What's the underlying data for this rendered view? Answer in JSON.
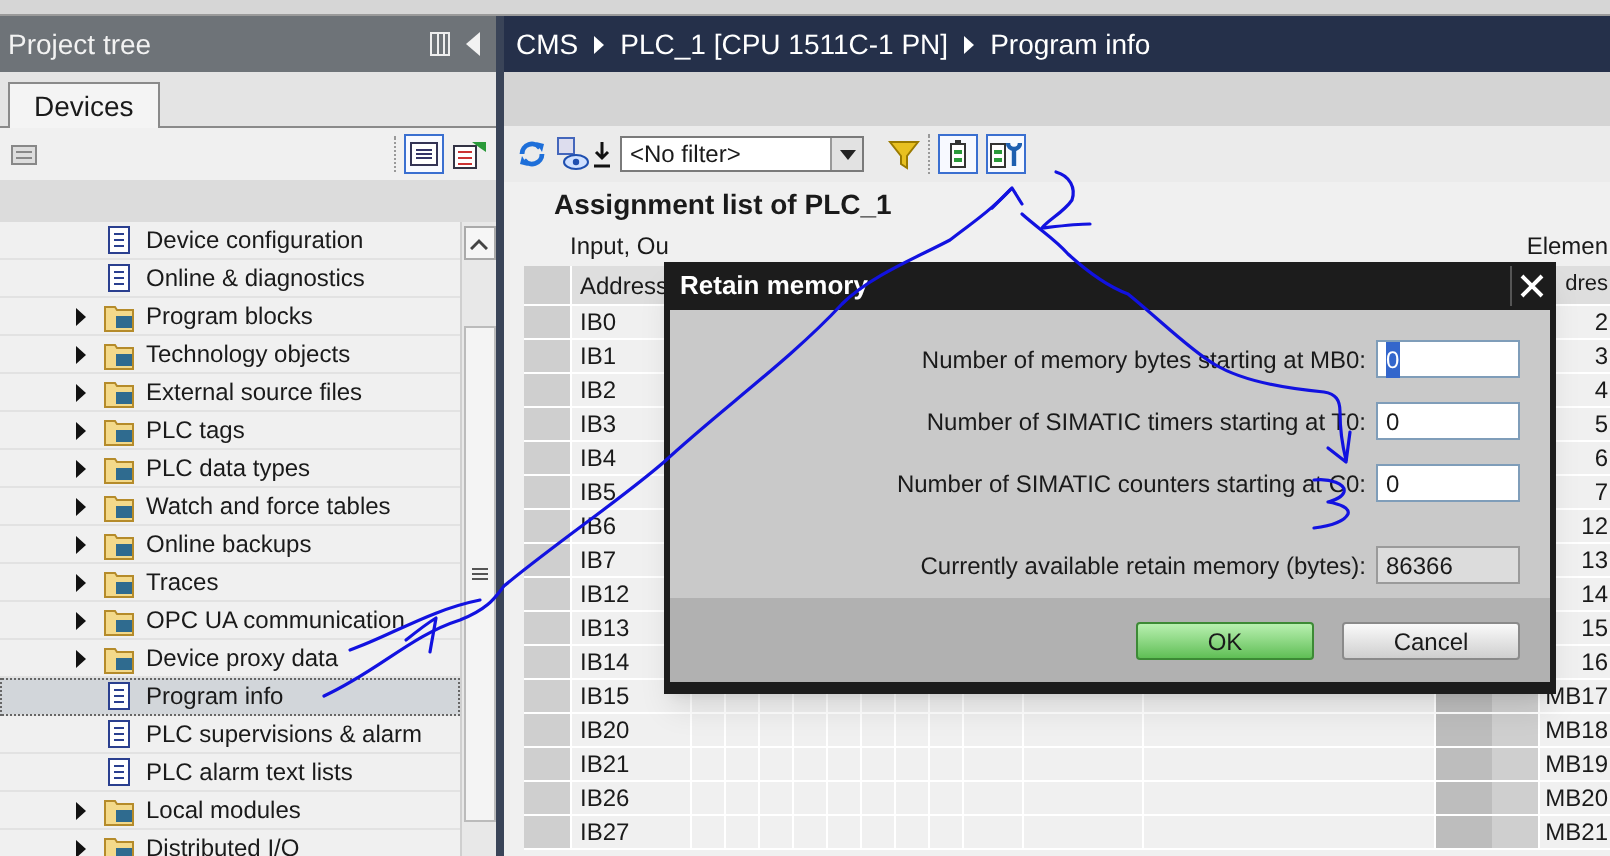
{
  "project_tree": {
    "title": "Project tree",
    "tab": {
      "label": "Devices",
      "selected": true
    },
    "items": [
      {
        "label": "Device configuration",
        "expandable": false,
        "selected": false
      },
      {
        "label": "Online & diagnostics",
        "expandable": false,
        "selected": false
      },
      {
        "label": "Program blocks",
        "expandable": true,
        "selected": false
      },
      {
        "label": "Technology objects",
        "expandable": true,
        "selected": false
      },
      {
        "label": "External source files",
        "expandable": true,
        "selected": false
      },
      {
        "label": "PLC tags",
        "expandable": true,
        "selected": false
      },
      {
        "label": "PLC data types",
        "expandable": true,
        "selected": false
      },
      {
        "label": "Watch and force tables",
        "expandable": true,
        "selected": false
      },
      {
        "label": "Online backups",
        "expandable": true,
        "selected": false
      },
      {
        "label": "Traces",
        "expandable": true,
        "selected": false
      },
      {
        "label": "OPC UA communication",
        "expandable": true,
        "selected": false
      },
      {
        "label": "Device proxy data",
        "expandable": true,
        "selected": false
      },
      {
        "label": "Program info",
        "expandable": false,
        "selected": true
      },
      {
        "label": "PLC supervisions & alarm",
        "expandable": false,
        "selected": false
      },
      {
        "label": "PLC alarm text lists",
        "expandable": false,
        "selected": false
      },
      {
        "label": "Local modules",
        "expandable": true,
        "selected": false
      },
      {
        "label": "Distributed I/O",
        "expandable": true,
        "selected": false
      }
    ]
  },
  "breadcrumb": [
    "CMS",
    "PLC_1 [CPU 1511C-1 PN]",
    "Program info"
  ],
  "toolbar": {
    "filter": "<No filter>"
  },
  "assignment_list": {
    "title": "Assignment list of PLC_1",
    "section_label": "Input, Ou",
    "right_label": "Elemen",
    "columns": [
      "Address",
      "dres"
    ],
    "rows": [
      [
        "IB0",
        "2"
      ],
      [
        "IB1",
        "3"
      ],
      [
        "IB2",
        "4"
      ],
      [
        "IB3",
        "5"
      ],
      [
        "IB4",
        "6"
      ],
      [
        "IB5",
        "7"
      ],
      [
        "IB6",
        "12"
      ],
      [
        "IB7",
        "13"
      ],
      [
        "IB12",
        "14"
      ],
      [
        "IB13",
        "15"
      ],
      [
        "IB14",
        "16"
      ],
      [
        "IB15",
        "MB17"
      ],
      [
        "IB20",
        "MB18"
      ],
      [
        "IB21",
        "MB19"
      ],
      [
        "IB26",
        "MB20"
      ],
      [
        "IB27",
        "MB21"
      ]
    ]
  },
  "dialog": {
    "title": "Retain memory",
    "fields": [
      {
        "label": "Number of memory bytes starting at MB0:",
        "value": "0",
        "text_selected": true,
        "readonly": false
      },
      {
        "label": "Number of SIMATIC timers starting at T0:",
        "value": "0",
        "text_selected": false,
        "readonly": false
      },
      {
        "label": "Number of SIMATIC counters starting at C0:",
        "value": "0",
        "text_selected": false,
        "readonly": false
      },
      {
        "label": "Currently available retain memory (bytes):",
        "value": "86366",
        "text_selected": false,
        "readonly": true
      }
    ],
    "buttons": [
      {
        "label": "OK",
        "kind": "primary"
      },
      {
        "label": "Cancel",
        "kind": "secondary"
      }
    ]
  }
}
